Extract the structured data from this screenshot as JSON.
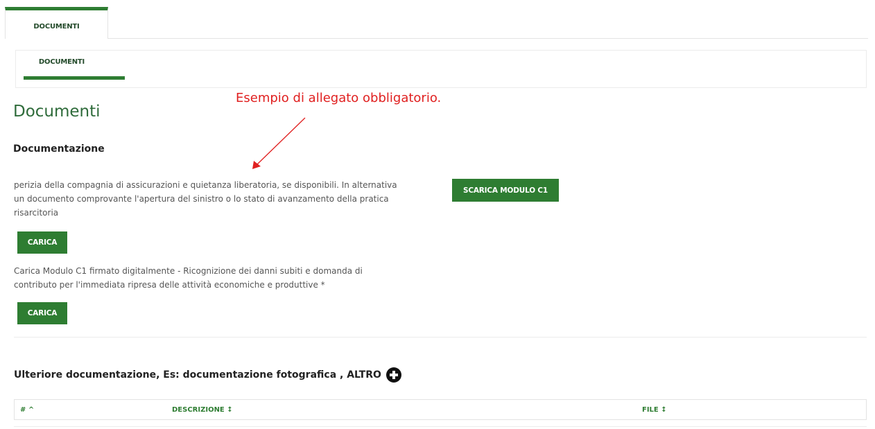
{
  "tabs": {
    "main_tab": "DOCUMENTI",
    "sub_tab": "DOCUMENTI"
  },
  "annotation": "Esempio di allegato obbligatorio.",
  "page": {
    "title": "Documenti",
    "section_title": "Documentazione"
  },
  "documents": [
    {
      "lines": [
        "perizia della compagnia di assicurazioni e quietanza liberatoria, se disponibili. In alternativa",
        "un documento comprovante l'apertura del sinistro o lo stato di avanzamento della pratica",
        "risarcitoria"
      ],
      "upload_label": "CARICA"
    },
    {
      "lines": [
        "Carica Modulo C1 firmato digitalmente - Ricognizione dei danni subiti e domanda di",
        "contributo per l'immediata ripresa delle attività economiche e produttive *"
      ],
      "upload_label": "CARICA"
    }
  ],
  "download_button": "SCARICA MODULO C1",
  "further_docs": {
    "title": "Ulteriore documentazione, Es: documentazione fotografica , ALTRO",
    "add_icon": "plus-circle-icon"
  },
  "table": {
    "headers": [
      "# ^",
      "DESCRIZIONE ↕",
      "FILE ↕"
    ]
  },
  "colors": {
    "accent": "#2e7d32",
    "title": "#2e6b3a",
    "annotation": "#e02020"
  }
}
